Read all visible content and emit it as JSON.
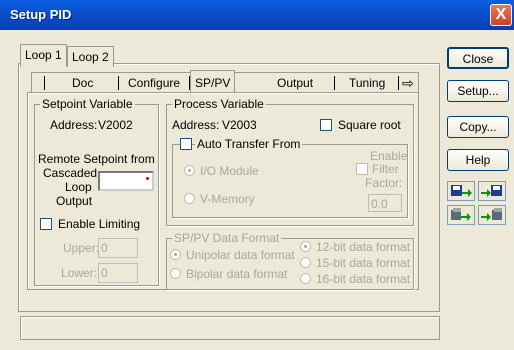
{
  "window": {
    "title": "Setup PID",
    "close_glyph": "X"
  },
  "loop_tabs": [
    "Loop 1",
    "Loop 2"
  ],
  "inner_tabs": [
    "Doc",
    "Configure",
    "SP/PV",
    "Output",
    "Tuning"
  ],
  "inner_tab_arrow": "⇨",
  "setpoint": {
    "group_label": "Setpoint Variable",
    "address_label": "Address:",
    "address_value": "V2002",
    "remote_label_1": "Remote Setpoint from",
    "remote_label_2": "Cascaded",
    "remote_label_3": "Loop",
    "remote_label_4": "Output",
    "remote_value": "",
    "enable_limiting": "Enable Limiting",
    "upper_label": "Upper:",
    "upper_value": "0",
    "lower_label": "Lower:",
    "lower_value": "0"
  },
  "process": {
    "group_label": "Process Variable",
    "address_label": "Address:",
    "address_value": "V2003",
    "square_root": "Square root",
    "auto_transfer": "Auto Transfer From",
    "io_module": "I/O Module",
    "v_memory": "V-Memory",
    "enable_filter_1": "Enable",
    "enable_filter_2": "Filter",
    "filter_factor_label": "Factor:",
    "filter_factor_value": "0.0"
  },
  "format": {
    "group_label": "SP/PV Data Format",
    "unipolar": "Unipolar data format",
    "bipolar": "Bipolar data format",
    "bit12": "12-bit data format",
    "bit15": "15-bit data format",
    "bit16": "16-bit data format"
  },
  "buttons": {
    "close": "Close",
    "setup": "Setup...",
    "copy": "Copy...",
    "help": "Help"
  },
  "status_text": ""
}
